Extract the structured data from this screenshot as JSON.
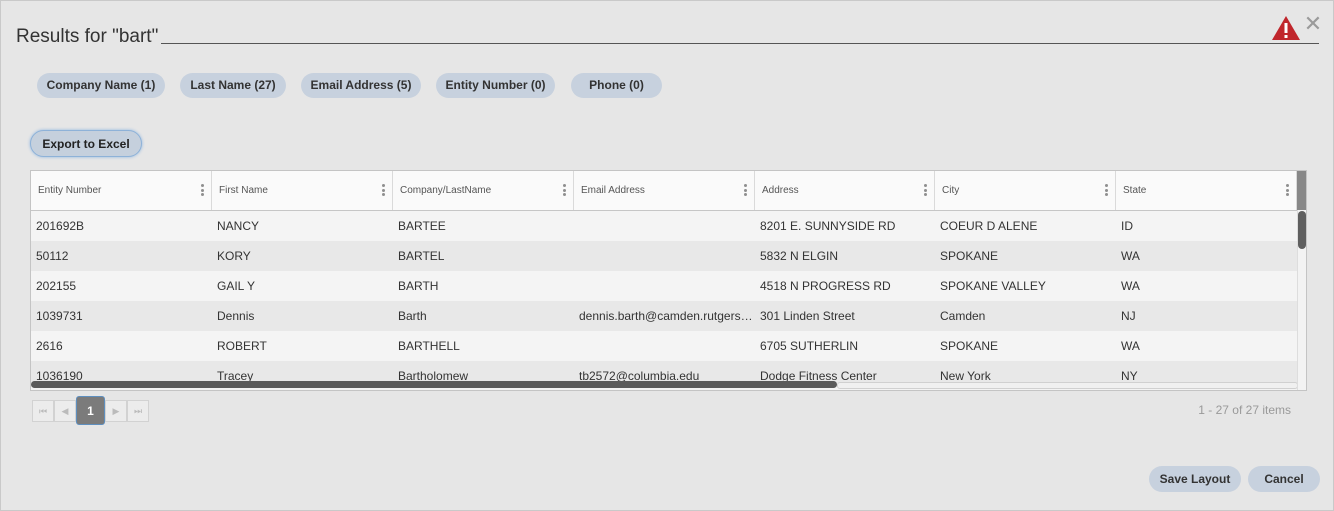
{
  "dialog": {
    "title": "Results for \"bart\"",
    "close_glyph": "✕",
    "warning_glyph": "!"
  },
  "filters": [
    {
      "label": "Company Name (1)"
    },
    {
      "label": "Last Name (27)"
    },
    {
      "label": "Email Address (5)"
    },
    {
      "label": "Entity Number (0)"
    },
    {
      "label": "Phone (0)"
    }
  ],
  "toolbar": {
    "export_label": "Export to Excel"
  },
  "grid": {
    "columns": [
      "Entity Number",
      "First Name",
      "Company/LastName",
      "Email Address",
      "Address",
      "City",
      "State"
    ],
    "rows": [
      [
        "201692B",
        "NANCY",
        "BARTEE",
        "",
        "8201 E. SUNNYSIDE RD",
        "COEUR D ALENE",
        "ID"
      ],
      [
        "50112",
        "KORY",
        "BARTEL",
        "",
        "5832 N ELGIN",
        "SPOKANE",
        "WA"
      ],
      [
        "202155",
        "GAIL Y",
        "BARTH",
        "",
        "4518 N PROGRESS RD",
        "SPOKANE VALLEY",
        "WA"
      ],
      [
        "1039731",
        "Dennis",
        "Barth",
        "dennis.barth@camden.rutgers.edu",
        "301 Linden Street",
        "Camden",
        "NJ"
      ],
      [
        "2616",
        "ROBERT",
        "BARTHELL",
        "",
        "6705 SUTHERLIN",
        "SPOKANE",
        "WA"
      ],
      [
        "1036190",
        "Tracey",
        "Bartholomew",
        "tb2572@columbia.edu",
        "Dodge Fitness Center",
        "New York",
        "NY"
      ]
    ]
  },
  "pager": {
    "first": "⏮",
    "prev": "◀",
    "current": "1",
    "next": "▶",
    "last": "⏭",
    "summary": "1 - 27 of 27 items"
  },
  "footer": {
    "save_label": "Save Layout",
    "cancel_label": "Cancel"
  },
  "colors": {
    "accent": "#c7d1de",
    "warning": "#c0262c"
  }
}
